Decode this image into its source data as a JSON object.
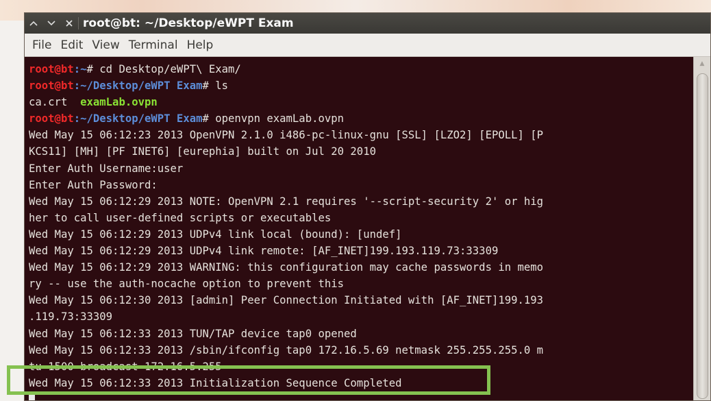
{
  "window": {
    "title": "root@bt: ~/Desktop/eWPT Exam",
    "controls": [
      "chevron-up-icon",
      "chevron-down-icon",
      "close-icon"
    ]
  },
  "menubar": {
    "items": [
      "File",
      "Edit",
      "View",
      "Terminal",
      "Help"
    ]
  },
  "terminal": {
    "colors": {
      "background": "#2c0b10",
      "text": "#e6e2dc",
      "prompt_user": "#ef2929",
      "prompt_path": "#5c8dd8",
      "executable": "#8ae234",
      "highlight_box": "#85c150"
    },
    "lines": [
      {
        "segments": [
          {
            "t": "root@bt",
            "c": "user"
          },
          {
            "t": ":~",
            "c": "path"
          },
          {
            "t": "# cd Desktop/eWPT\\ Exam/",
            "c": "text"
          }
        ]
      },
      {
        "segments": [
          {
            "t": "root@bt",
            "c": "user"
          },
          {
            "t": ":~/Desktop/eWPT Exam",
            "c": "path"
          },
          {
            "t": "# ls",
            "c": "text"
          }
        ]
      },
      {
        "segments": [
          {
            "t": "ca.crt  ",
            "c": "text"
          },
          {
            "t": "examLab.ovpn",
            "c": "exec"
          }
        ]
      },
      {
        "segments": [
          {
            "t": "root@bt",
            "c": "user"
          },
          {
            "t": ":~/Desktop/eWPT Exam",
            "c": "path"
          },
          {
            "t": "# openvpn examLab.ovpn",
            "c": "text"
          }
        ]
      },
      {
        "segments": [
          {
            "t": "Wed May 15 06:12:23 2013 OpenVPN 2.1.0 i486-pc-linux-gnu [SSL] [LZO2] [EPOLL] [P",
            "c": "text"
          }
        ]
      },
      {
        "segments": [
          {
            "t": "KCS11] [MH] [PF INET6] [eurephia] built on Jul 20 2010",
            "c": "text"
          }
        ]
      },
      {
        "segments": [
          {
            "t": "Enter Auth Username:user",
            "c": "text"
          }
        ]
      },
      {
        "segments": [
          {
            "t": "Enter Auth Password:",
            "c": "text"
          }
        ]
      },
      {
        "segments": [
          {
            "t": "Wed May 15 06:12:29 2013 NOTE: OpenVPN 2.1 requires '--script-security 2' or hig",
            "c": "text"
          }
        ]
      },
      {
        "segments": [
          {
            "t": "her to call user-defined scripts or executables",
            "c": "text"
          }
        ]
      },
      {
        "segments": [
          {
            "t": "Wed May 15 06:12:29 2013 UDPv4 link local (bound): [undef]",
            "c": "text"
          }
        ]
      },
      {
        "segments": [
          {
            "t": "Wed May 15 06:12:29 2013 UDPv4 link remote: [AF_INET]199.193.119.73:33309",
            "c": "text"
          }
        ]
      },
      {
        "segments": [
          {
            "t": "Wed May 15 06:12:29 2013 WARNING: this configuration may cache passwords in memo",
            "c": "text"
          }
        ]
      },
      {
        "segments": [
          {
            "t": "ry -- use the auth-nocache option to prevent this",
            "c": "text"
          }
        ]
      },
      {
        "segments": [
          {
            "t": "Wed May 15 06:12:30 2013 [admin] Peer Connection Initiated with [AF_INET]199.193",
            "c": "text"
          }
        ]
      },
      {
        "segments": [
          {
            "t": ".119.73:33309",
            "c": "text"
          }
        ]
      },
      {
        "segments": [
          {
            "t": "Wed May 15 06:12:33 2013 TUN/TAP device tap0 opened",
            "c": "text"
          }
        ]
      },
      {
        "segments": [
          {
            "t": "Wed May 15 06:12:33 2013 /sbin/ifconfig tap0 172.16.5.69 netmask 255.255.255.0 m",
            "c": "text"
          }
        ]
      },
      {
        "segments": [
          {
            "t": "tu 1500 broadcast 172.16.5.255",
            "c": "text"
          }
        ]
      },
      {
        "segments": [
          {
            "t": "Wed May 15 06:12:33 2013 Initialization Sequence Completed",
            "c": "text"
          }
        ]
      }
    ]
  }
}
